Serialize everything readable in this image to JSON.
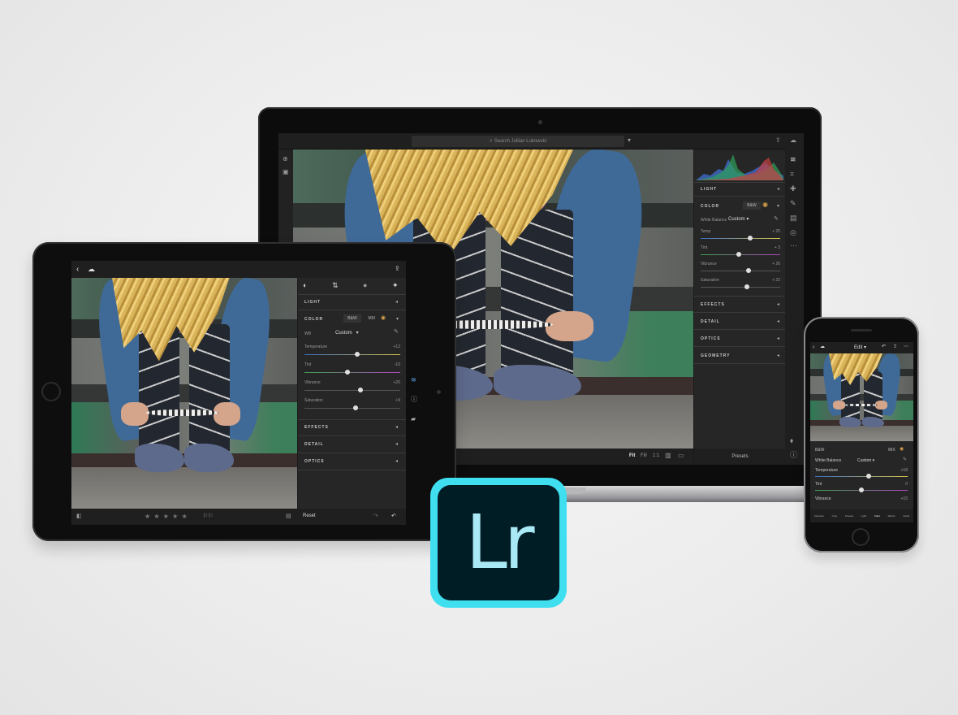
{
  "laptop": {
    "search_placeholder": "Search Jullian Lukowski",
    "histogram_colors": [
      "#3d6cc7",
      "#2fa05a",
      "#c84040",
      "#8a5ad1"
    ],
    "sections": {
      "light": "LIGHT",
      "color": "COLOR",
      "bw_button": "B&W",
      "white_balance_label": "White Balance",
      "white_balance_value": "Custom",
      "effects": "EFFECTS",
      "detail": "DETAIL",
      "optics": "OPTICS",
      "geometry": "GEOMETRY"
    },
    "sliders": [
      {
        "label": "Temp",
        "value": "+ 25"
      },
      {
        "label": "Tint",
        "value": "+ 3"
      },
      {
        "label": "Vibrance",
        "value": "+ 26"
      },
      {
        "label": "Saturation",
        "value": "+ 22"
      }
    ],
    "bottom": {
      "fit": "Fit",
      "fill": "Fill",
      "one_to_one": "1:1",
      "presets": "Presets",
      "stars": "★ ★ ★ ★ ★"
    }
  },
  "tablet": {
    "sections": {
      "light": "LIGHT",
      "color": "COLOR",
      "bw_button": "B&W",
      "mix_button": "MIX",
      "wb_label": "WB",
      "wb_value": "Custom",
      "effects": "EFFECTS",
      "detail": "DETAIL",
      "optics": "OPTICS"
    },
    "sliders": [
      {
        "label": "Temperature",
        "value": "+12"
      },
      {
        "label": "Tint",
        "value": "-10"
      },
      {
        "label": "Vibrance",
        "value": "+20"
      },
      {
        "label": "Saturation",
        "value": "+9"
      }
    ],
    "bottom": {
      "stars": "★ ★ ★ ★ ★",
      "reset": "Reset"
    }
  },
  "phone": {
    "edit_label": "Edit",
    "bw_button": "B&W",
    "mix_button": "MIX",
    "white_balance_label": "White Balance",
    "white_balance_value": "Custom",
    "sliders": [
      {
        "label": "Temperature",
        "value": "+18"
      },
      {
        "label": "Tint",
        "value": "0"
      },
      {
        "label": "Vibrance",
        "value": "+15"
      }
    ],
    "toolbar": [
      "Selective",
      "Crop",
      "Presets",
      "Light",
      "Color",
      "Effects",
      "Detail"
    ]
  },
  "logo": {
    "text": "Lr"
  }
}
